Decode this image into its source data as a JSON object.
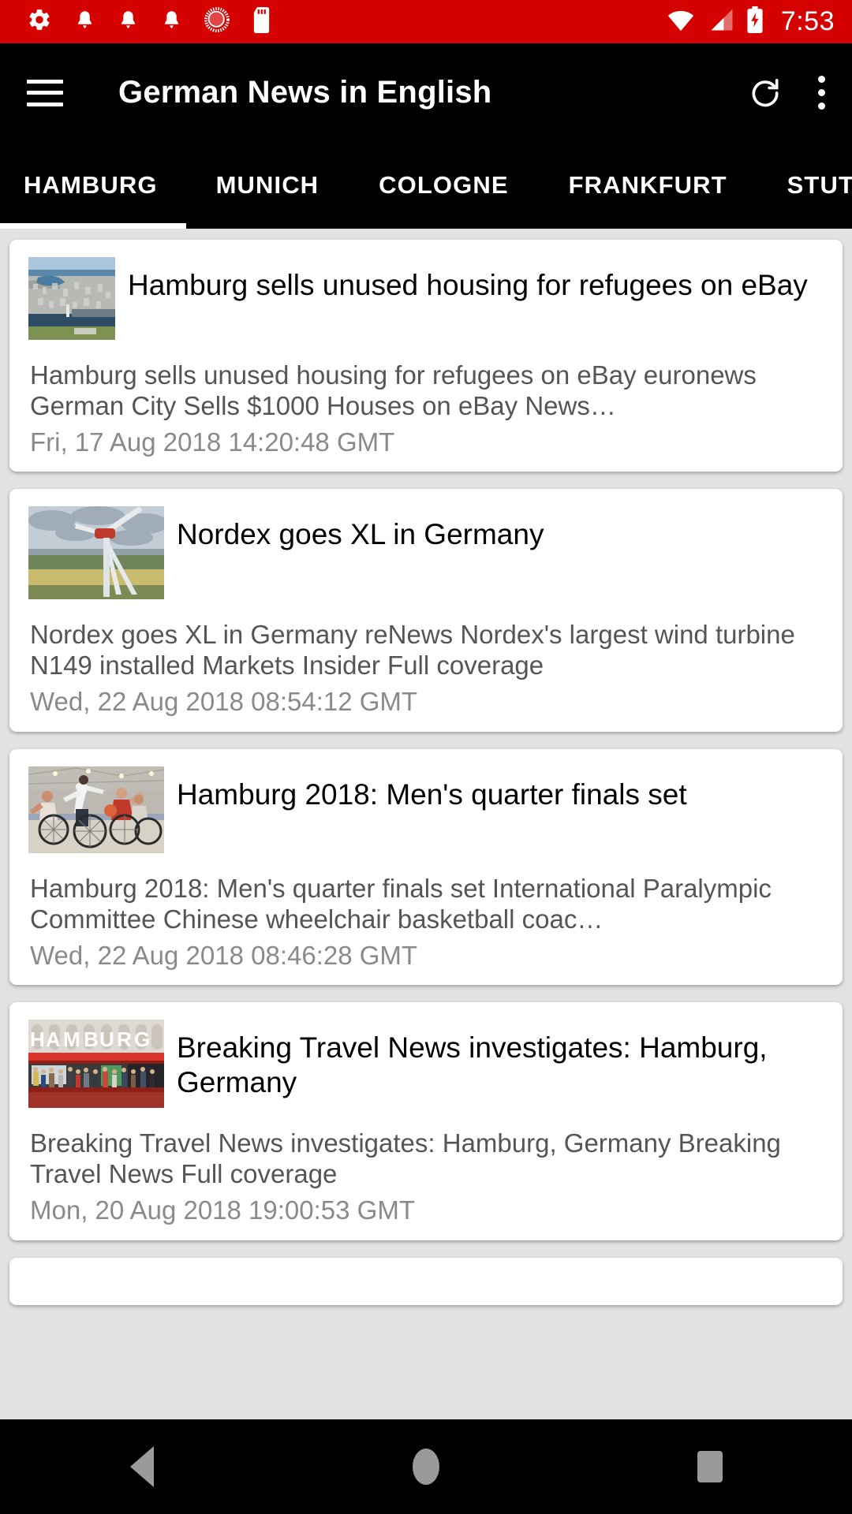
{
  "status_bar": {
    "background_color": "#d50000",
    "time": "7:53",
    "left_icons": [
      "gear-icon",
      "bell-icon",
      "bell-icon",
      "bell-icon",
      "sync-circle-icon",
      "sd-card-icon"
    ],
    "right_icons": [
      "wifi-icon",
      "cellular-signal-icon",
      "battery-charging-icon"
    ]
  },
  "app_bar": {
    "background_color": "#000000",
    "menu_icon": "hamburger-menu-icon",
    "title": "German News in English",
    "refresh_icon": "refresh-icon",
    "overflow_icon": "more-vertical-icon"
  },
  "tabs": {
    "active_index": 0,
    "indicator_color": "#ffffff",
    "items": [
      {
        "label": "HAMBURG"
      },
      {
        "label": "MUNICH"
      },
      {
        "label": "COLOGNE"
      },
      {
        "label": "FRANKFURT"
      },
      {
        "label": "STUTTGART"
      }
    ]
  },
  "articles": [
    {
      "title": "Hamburg sells unused housing for refugees on eBay",
      "description": "Hamburg sells unused housing for refugees on eBay  euronews  German City Sells $1000 Houses on eBay  News…",
      "date": "Fri, 17 Aug 2018 14:20:48 GMT",
      "thumbnail": "aerial-view-of-hamburg-city-thumbnail"
    },
    {
      "title": "Nordex goes XL in Germany",
      "description": "Nordex goes XL in Germany  reNews  Nordex's largest wind turbine N149 installed  Markets Insider  Full coverage",
      "date": "Wed, 22 Aug 2018 08:54:12 GMT",
      "thumbnail": "wind-turbine-thumbnail"
    },
    {
      "title": "Hamburg 2018: Men's quarter finals set",
      "description": "Hamburg 2018: Men's quarter finals set  International Paralympic Committee  Chinese wheelchair basketball coac…",
      "date": "Wed, 22 Aug 2018 08:46:28 GMT",
      "thumbnail": "wheelchair-basketball-thumbnail"
    },
    {
      "title": "Breaking Travel News investigates: Hamburg, Germany",
      "description": "Breaking Travel News investigates: Hamburg, Germany  Breaking Travel News  Full coverage",
      "date": "Mon, 20 Aug 2018 19:00:53 GMT",
      "thumbnail": "hamburg-sign-building-thumbnail"
    }
  ],
  "nav_bar": {
    "background_color": "#000000",
    "back_icon": "back-triangle-icon",
    "home_icon": "home-circle-icon",
    "recents_icon": "recents-square-icon"
  }
}
